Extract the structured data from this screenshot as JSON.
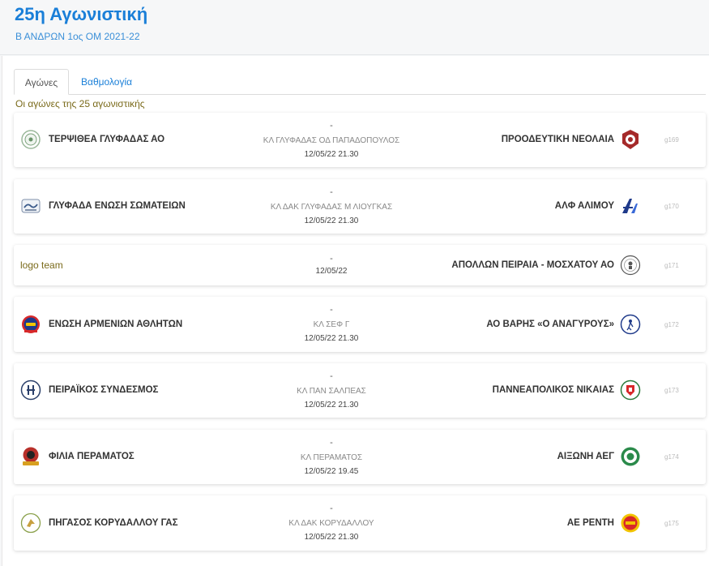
{
  "header": {
    "title": "25η Αγωνιστική",
    "subtitle": "Β ΑΝΔΡΩΝ 1ος ΟΜ 2021-22"
  },
  "tabs": [
    {
      "label": "Αγώνες",
      "active": true
    },
    {
      "label": "Βαθμολογία",
      "active": false
    }
  ],
  "round_note": "Οι αγώνες της 25 αγωνιστικής",
  "matches": [
    {
      "home": "ΤΕΡΨΙΘΕΑ ΓΛΥΦΑΔΑΣ ΑΟ",
      "home_logo": "terpsithea-logo",
      "score": "-",
      "venue": "ΚΛ ΓΛΥΦΑΔΑΣ ΟΔ ΠΑΠΑΔΟΠΟΥΛΟΣ",
      "datetime": "12/05/22 21.30",
      "away": "ΠΡΟΟΔΕΥΤΙΚΗ ΝΕΟΛΑΙΑ",
      "away_logo": "proodeftiki-logo",
      "code": "g169"
    },
    {
      "home": "ΓΛΥΦΑΔΑ ΕΝΩΣΗ ΣΩΜΑΤΕΙΩΝ",
      "home_logo": "glyfada-logo",
      "score": "-",
      "venue": "ΚΛ ΔΑΚ ΓΛΥΦΑΔΑΣ Μ ΛΙΟΥΓΚΑΣ",
      "datetime": "12/05/22 21.30",
      "away": "ΑΛΦ ΑΛΙΜΟΥ",
      "away_logo": "alf-alimou-logo",
      "code": "g170"
    },
    {
      "home": "",
      "home_logo_alt": "logo team",
      "score": "-",
      "venue": "",
      "datetime": "12/05/22",
      "away": "ΑΠΟΛΛΩΝ ΠΕΙΡΑΙΑ - ΜΟΣΧΑΤΟΥ ΑΟ",
      "away_logo": "apollon-logo",
      "code": "g171"
    },
    {
      "home": "ΕΝΩΣΗ ΑΡΜΕΝΙΩΝ ΑΘΛΗΤΩΝ",
      "home_logo": "armenion-logo",
      "score": "-",
      "venue": "ΚΛ ΣΕΦ Γ",
      "datetime": "12/05/22 21.30",
      "away": "ΑΟ ΒΑΡΗΣ «Ο ΑΝΑΓΥΡΟΥΣ»",
      "away_logo": "vari-logo",
      "code": "g172"
    },
    {
      "home": "ΠΕΙΡΑΪΚΟΣ ΣΥΝΔΕΣΜΟΣ",
      "home_logo": "peiraikos-logo",
      "score": "-",
      "venue": "ΚΛ ΠΑΝ ΣΑΛΠΕΑΣ",
      "datetime": "12/05/22 21.30",
      "away": "ΠΑΝΝΕΑΠΟΛΙΚΟΣ ΝΙΚΑΙΑΣ",
      "away_logo": "panneapolikos-logo",
      "code": "g173"
    },
    {
      "home": "ΦΙΛΙΑ ΠΕΡΑΜΑΤΟΣ",
      "home_logo": "filia-logo",
      "score": "-",
      "venue": "ΚΛ ΠΕΡΑΜΑΤΟΣ",
      "datetime": "12/05/22 19.45",
      "away": "ΑΙΞΩΝΗ ΑΕΓ",
      "away_logo": "aixoni-logo",
      "code": "g174"
    },
    {
      "home": "ΠΗΓΑΣΟΣ ΚΟΡΥΔΑΛΛΟΥ ΓΑΣ",
      "home_logo": "pigasos-logo",
      "score": "-",
      "venue": "ΚΛ ΔΑΚ ΚΟΡΥΔΑΛΛΟΥ",
      "datetime": "12/05/22 21.30",
      "away": "ΑΕ ΡΕΝΤΗ",
      "away_logo": "renti-logo",
      "code": "g175"
    }
  ],
  "colors": {
    "accent": "#1a7fd8",
    "note": "#7a6a1a"
  }
}
